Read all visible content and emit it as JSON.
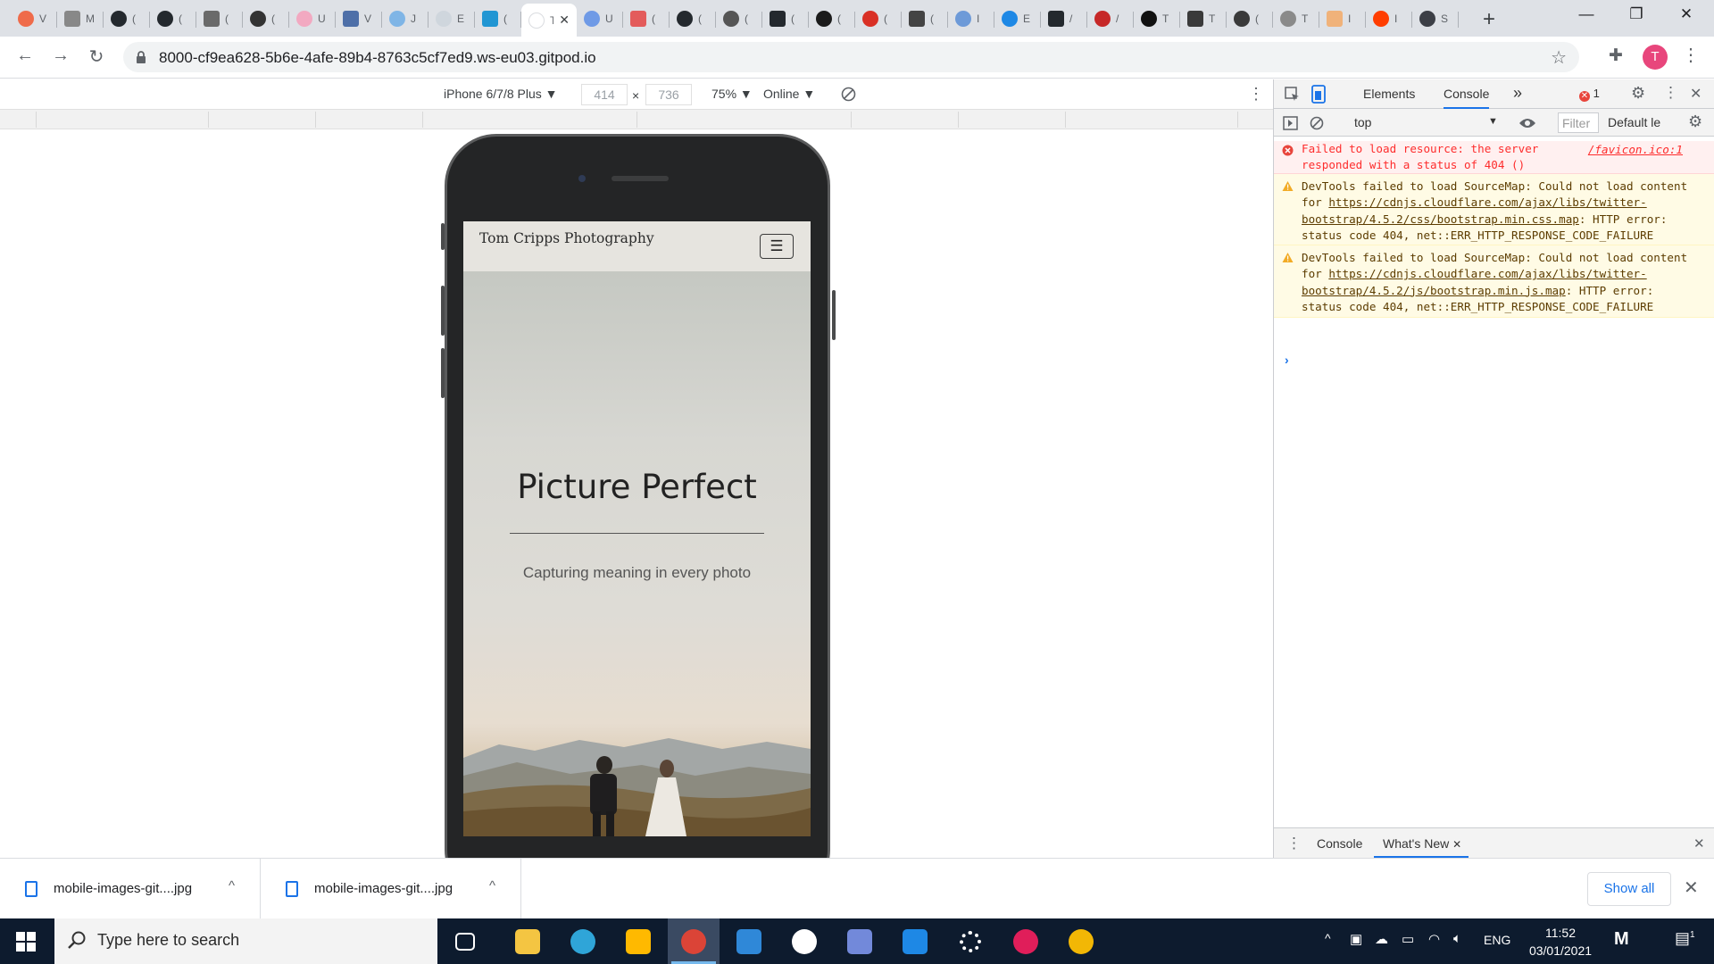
{
  "browser": {
    "tabs": [
      {
        "title": "V",
        "color": "#ef6b4a"
      },
      {
        "title": "M",
        "color": "#888888"
      },
      {
        "title": "(",
        "color": "#24292e"
      },
      {
        "title": "(",
        "color": "#24292e"
      },
      {
        "title": "(",
        "color": "#6a6a6a"
      },
      {
        "title": "(",
        "color": "#333333"
      },
      {
        "title": "U",
        "color": "#f2a9c1"
      },
      {
        "title": "V",
        "color": "#4e6fa8"
      },
      {
        "title": "J",
        "color": "#7fb5e6"
      },
      {
        "title": "E",
        "color": "#cfd6dd"
      },
      {
        "title": "(",
        "color": "#2196d3"
      },
      {
        "title": "T",
        "color": "#ffffff",
        "active": true
      },
      {
        "title": "U",
        "color": "#6f9ae6"
      },
      {
        "title": "(",
        "color": "#e35b5b"
      },
      {
        "title": "(",
        "color": "#24292e"
      },
      {
        "title": "(",
        "color": "#555555"
      },
      {
        "title": "(",
        "color": "#24292e"
      },
      {
        "title": "(",
        "color": "#1b1b1b"
      },
      {
        "title": "(",
        "color": "#d93025"
      },
      {
        "title": "(",
        "color": "#444444"
      },
      {
        "title": "I",
        "color": "#6d9ad8"
      },
      {
        "title": "E",
        "color": "#1e88e5"
      },
      {
        "title": "/",
        "color": "#24292e"
      },
      {
        "title": "/",
        "color": "#c62828"
      },
      {
        "title": "T",
        "color": "#111111"
      },
      {
        "title": "T",
        "color": "#3a3a3a"
      },
      {
        "title": "(",
        "color": "#3a3a3a"
      },
      {
        "title": "T",
        "color": "#8a8a8a"
      },
      {
        "title": "I",
        "color": "#f0b27a"
      },
      {
        "title": "I",
        "color": "#ff3d00"
      },
      {
        "title": "S",
        "color": "#3c3f46"
      }
    ],
    "active_tab_close": "✕",
    "new_tab": "+",
    "url": "8000-cf9ea628-5b6e-4afe-89b4-8763c5cf7ed9.ws-eu03.gitpod.io",
    "profile_initial": "T"
  },
  "device_toolbar": {
    "device": "iPhone 6/7/8 Plus ▼",
    "width": "414",
    "times": "×",
    "height": "736",
    "zoom": "75% ▼",
    "network": "Online ▼"
  },
  "site": {
    "brand": "Tom Cripps Photography",
    "menu_icon": "☰",
    "hero_title": "Picture Perfect",
    "hero_subtitle": "Capturing meaning in every photo"
  },
  "devtools": {
    "tab_elements": "Elements",
    "tab_console": "Console",
    "more_tabs": "»",
    "error_count": "1",
    "context": "top",
    "context_arrow": "▼",
    "filter_placeholder": "Filter",
    "levels": "Default le",
    "messages": [
      {
        "type": "error",
        "text": "Failed to load resource: the server responded with a status of 404 ()",
        "source": "/favicon.ico:1"
      },
      {
        "type": "warning",
        "prefix": "DevTools failed to load SourceMap: Could not load content for ",
        "link": "https://cdnjs.cloudflare.com/ajax/libs/twitter-bootstrap/4.5.2/css/bootstrap.min.css.map",
        "suffix": ": HTTP error: status code 404, net::ERR_HTTP_RESPONSE_CODE_FAILURE"
      },
      {
        "type": "warning",
        "prefix": "DevTools failed to load SourceMap: Could not load content for ",
        "link": "https://cdnjs.cloudflare.com/ajax/libs/twitter-bootstrap/4.5.2/js/bootstrap.min.js.map",
        "suffix": ": HTTP error: status code 404, net::ERR_HTTP_RESPONSE_CODE_FAILURE"
      }
    ],
    "prompt": "›",
    "drawer_console": "Console",
    "drawer_whatsnew": "What's New",
    "drawer_whatsnew_close": "✕",
    "drawer_close": "✕"
  },
  "downloads": {
    "items": [
      {
        "name": "mobile-images-git....jpg",
        "chevron": "^"
      },
      {
        "name": "mobile-images-git....jpg",
        "chevron": "^"
      }
    ],
    "show_all": "Show all",
    "close": "✕"
  },
  "taskbar": {
    "search_placeholder": "Type here to search",
    "apps": [
      {
        "name": "task-view",
        "color": "#ffffff"
      },
      {
        "name": "file-explorer",
        "color": "#f4c542"
      },
      {
        "name": "edge",
        "color": "#2fa5d8"
      },
      {
        "name": "store",
        "color": "#ffb900"
      },
      {
        "name": "chrome",
        "color": "#db4437",
        "active": true
      },
      {
        "name": "mail",
        "color": "#2f88d8"
      },
      {
        "name": "emoji",
        "color": "#ffffff"
      },
      {
        "name": "discord",
        "color": "#7289da"
      },
      {
        "name": "app-j",
        "color": "#1e88e5"
      },
      {
        "name": "settings",
        "color": "#ffffff"
      },
      {
        "name": "slack",
        "color": "#e01e5a"
      },
      {
        "name": "paint",
        "color": "#f2b705"
      }
    ],
    "language": "ENG",
    "time": "11:52",
    "date": "03/01/2021",
    "notification_count": "1"
  }
}
